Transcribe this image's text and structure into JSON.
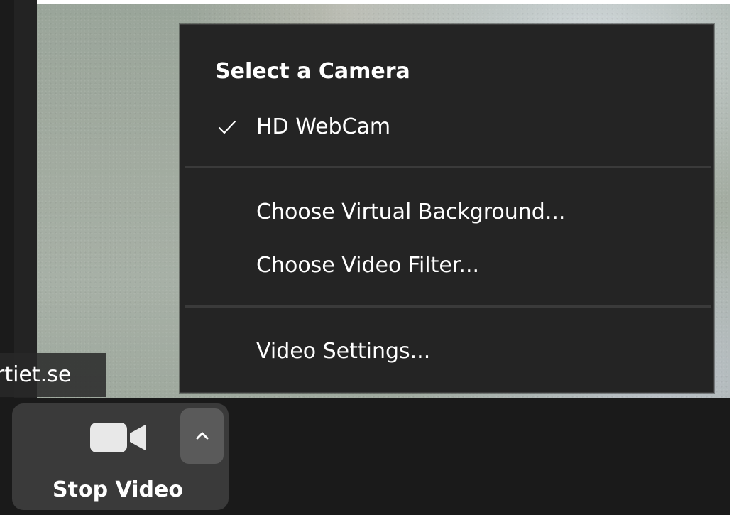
{
  "participant": {
    "name_fragment": "rtiet.se"
  },
  "toolbar": {
    "stop_video_label": "Stop Video",
    "camera_icon": "video-camera-icon",
    "caret_icon": "chevron-up-icon"
  },
  "camera_menu": {
    "title": "Select a Camera",
    "cameras": [
      {
        "label": "HD WebCam",
        "selected": true
      }
    ],
    "items": [
      {
        "label": "Choose Virtual Background..."
      },
      {
        "label": "Choose Video Filter..."
      },
      {
        "label": "Video Settings..."
      }
    ]
  },
  "colors": {
    "menu_bg": "#242424",
    "toolbar_bg": "#1a1a1a",
    "button_group_bg": "#3a3a3a",
    "caret_bg": "#5a5a5a",
    "text": "#ffffff"
  }
}
